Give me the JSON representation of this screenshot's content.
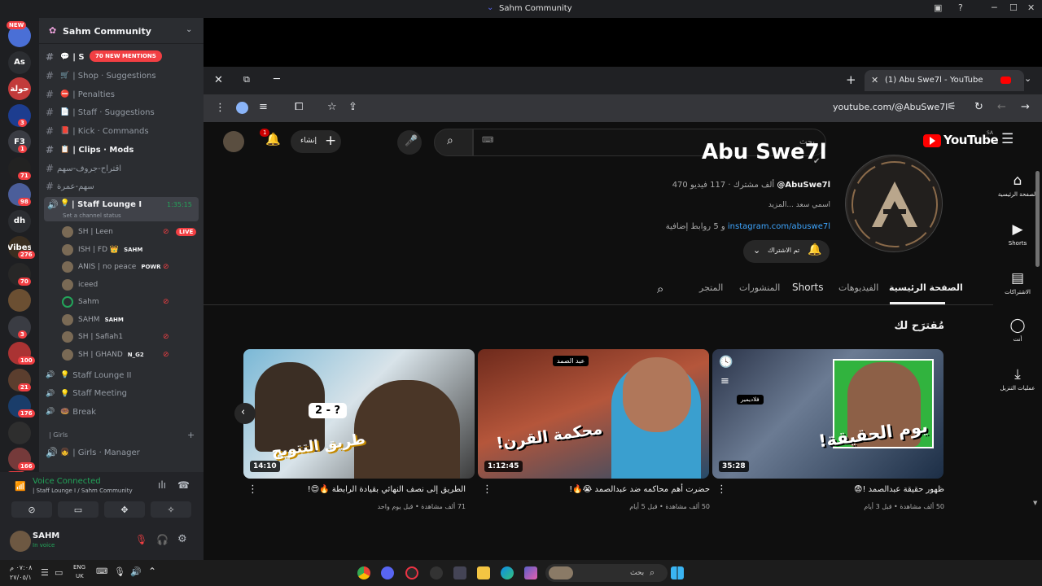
{
  "window": {
    "title": "Sahm Community"
  },
  "discord": {
    "server_name": "Sahm Community",
    "new_mentions": "70 NEW MENTIONS",
    "rail": [
      {
        "label": "",
        "badge": "NEW"
      },
      {
        "label": "As",
        "badge": ""
      },
      {
        "label": "حولة",
        "badge": ""
      },
      {
        "label": "",
        "badge": "3"
      },
      {
        "label": "F3",
        "badge": "1"
      },
      {
        "label": "",
        "badge": "71"
      },
      {
        "label": "",
        "badge": "98"
      },
      {
        "label": "dh",
        "badge": ""
      },
      {
        "label": "Vibes",
        "badge": "276"
      },
      {
        "label": "",
        "badge": "70"
      },
      {
        "label": "",
        "badge": ""
      },
      {
        "label": "",
        "badge": "3"
      },
      {
        "label": "",
        "badge": "100"
      },
      {
        "label": "",
        "badge": "21"
      },
      {
        "label": "",
        "badge": "176"
      },
      {
        "label": "",
        "badge": ""
      },
      {
        "label": "",
        "badge": "166"
      },
      {
        "label": "",
        "badge": "NEW"
      }
    ],
    "channels": [
      {
        "icon": "💬",
        "name": "| S",
        "bright": true
      },
      {
        "icon": "🛒",
        "name": "| Shop · Suggestions",
        "bright": false
      },
      {
        "icon": "⛔",
        "name": "| Penalties",
        "bright": false
      },
      {
        "icon": "📄",
        "name": "| Staff · Suggestions",
        "bright": false
      },
      {
        "icon": "📕",
        "name": "| Kick · Commands",
        "bright": false
      },
      {
        "icon": "📋",
        "name": "| Clips · Mods",
        "bright": true
      },
      {
        "icon": "",
        "name": "اقتراح-جروف-سهم",
        "bright": false
      },
      {
        "icon": "",
        "name": "سهم-عمرة",
        "bright": false
      }
    ],
    "active_voice": {
      "name": "| Staff Lounge I",
      "timer": "1:35:15",
      "status": "Set a channel status"
    },
    "voice_users": [
      {
        "name": "SH | Leen",
        "tag": "LIVE"
      },
      {
        "name": "ISH | FD 👑",
        "tag": "SAHM"
      },
      {
        "name": "ANIS | no peace",
        "tag": "POWR"
      },
      {
        "name": "iceed",
        "tag": ""
      },
      {
        "name": "Sahm",
        "tag": ""
      },
      {
        "name": "SAHM",
        "tag": "SAHM"
      },
      {
        "name": "SH | Safiah1",
        "tag": ""
      },
      {
        "name": "SH | GHAND",
        "tag": "N_G2"
      }
    ],
    "other_channels": [
      {
        "icon": "💡",
        "name": "Staff Lounge II"
      },
      {
        "icon": "💡",
        "name": "Staff Meeting"
      },
      {
        "icon": "🍩",
        "name": "Break"
      }
    ],
    "category": "| Girls",
    "girls_channel": "| Girls · Manager",
    "voice_connected": "Voice Connected",
    "voice_location": "| Staff Lounge I / Sahm Community",
    "user_name": "SAHM",
    "user_status": "In voice"
  },
  "browser": {
    "tab_title": "(1) Abu Swe7l - YouTube",
    "url": "youtube.com/@AbuSwe7l"
  },
  "youtube": {
    "logo": "YouTube",
    "region": "SA",
    "search_placeholder": "بحث",
    "create_label": "إنشاء",
    "notif_count": "1",
    "channel_name": "Abu Swe7l",
    "handle": "@AbuSwe7l",
    "stats": "470 ألف مشترك · 117 فيديو",
    "description": "اسمي سعد ...المزيد",
    "links": "instagram.com/abuswe7l",
    "links_more": "و 5 روابط إضافية",
    "subscribed_label": "تم الاشتراك",
    "tabs": [
      "الصفحة الرئيسية",
      "الفيديوهات",
      "Shorts",
      "المنشورات",
      "المتجر"
    ],
    "section_title": "مُقترَح لك",
    "sidenav": [
      {
        "icon": "home-icon",
        "label": "الصفحة الرئيسية"
      },
      {
        "icon": "shorts-icon",
        "label": "Shorts"
      },
      {
        "icon": "subscriptions-icon",
        "label": "الاشتراكات"
      },
      {
        "icon": "you-icon",
        "label": "أنت"
      },
      {
        "icon": "downloads-icon",
        "label": "عمليات التنزيل"
      }
    ],
    "videos": [
      {
        "title": "ظهور حقيقة عبدالصمد !😨",
        "meta": "50 ألف مشاهدة • قبل 3 أيام",
        "duration": "35:28",
        "thumb_text": "يوم الحقيقة!",
        "thumb_tag": "فلاديمير"
      },
      {
        "title": "حضرت أهم محاكمه ضد عبدالصمد 😭🔥!",
        "meta": "50 ألف مشاهدة • قبل 5 أيام",
        "duration": "1:12:45",
        "thumb_text": "محكمة القرن!",
        "thumb_tag": "عبد الصمد"
      },
      {
        "title": "الطريق إلى نصف النهائي بقيادة الرابطة 🔥😍!",
        "meta": "71 ألف مشاهدة • قبل يوم واحد",
        "duration": "14:10",
        "thumb_text": "طريق التتويج",
        "thumb_tag": "2 - ?"
      }
    ]
  },
  "taskbar": {
    "lang": "ENG",
    "region": "UK",
    "time": "٠٧:٠٨ م",
    "date": "٢٧/٠٥/١",
    "search": "بحث"
  }
}
